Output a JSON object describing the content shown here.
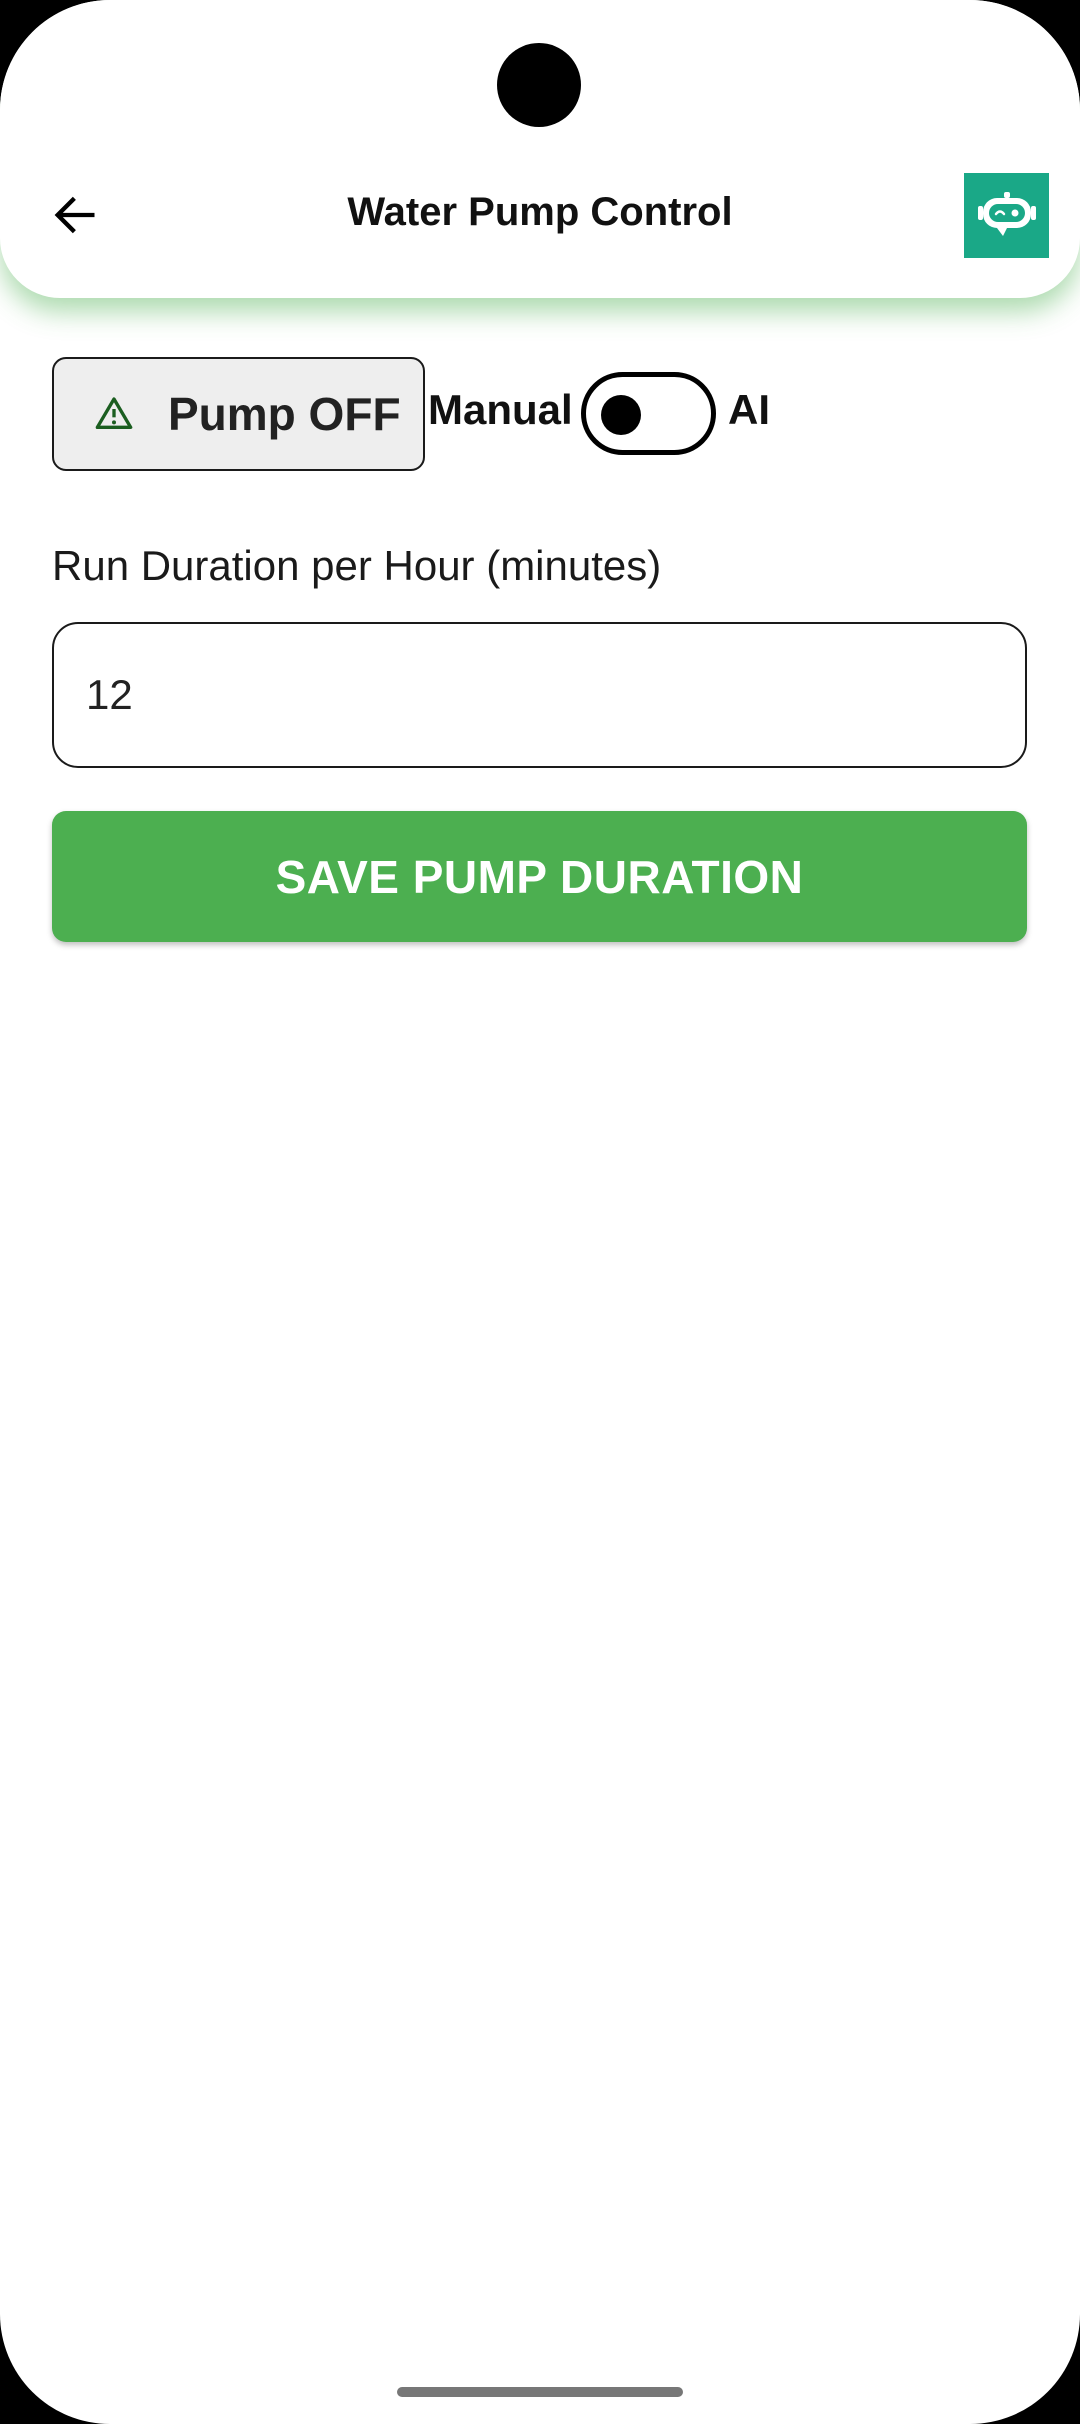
{
  "header": {
    "title": "Water Pump Control",
    "back_icon": "arrow-left-icon",
    "assistant_icon": "robot-chat-icon",
    "accent_color": "#4caf50",
    "assistant_color": "#1aa887"
  },
  "pump": {
    "status_label": "Pump OFF",
    "status_icon": "warning-triangle-icon",
    "icon_color": "#1b5e20"
  },
  "mode": {
    "manual_label": "Manual",
    "ai_label": "AI",
    "toggle_on": false
  },
  "duration": {
    "label": "Run Duration per Hour (minutes)",
    "value": "12"
  },
  "actions": {
    "save_label": "SAVE PUMP DURATION"
  }
}
